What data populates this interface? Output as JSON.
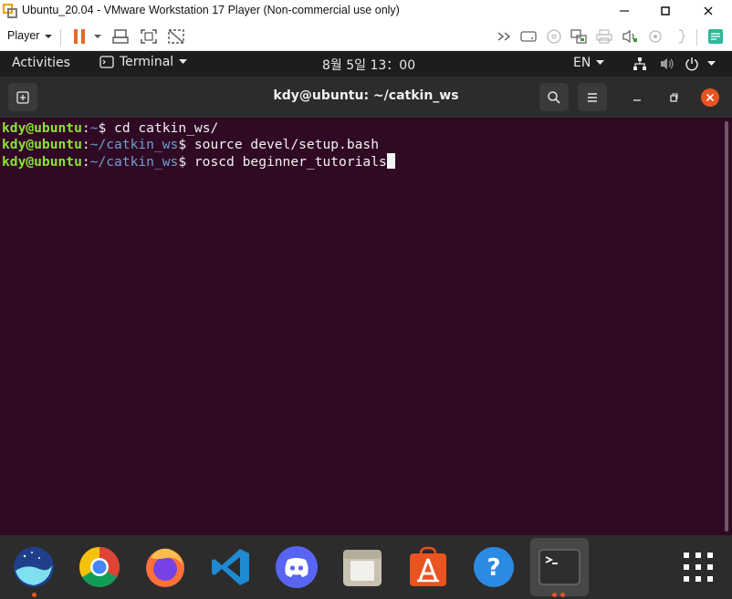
{
  "vm_window": {
    "title": "Ubuntu_20.04 - VMware Workstation 17 Player (Non-commercial use only)",
    "controls": [
      "minimize-icon",
      "maximize-icon",
      "close-icon"
    ]
  },
  "vm_toolbar": {
    "player_label": "Player",
    "icons": [
      "pause-icon",
      "dropdown-arrow-icon",
      "send-ctrl-alt-del-icon",
      "fit-guest-icon",
      "unity-icon",
      "fast-forward-icon",
      "hdd-icon",
      "cd-icon",
      "network-icon",
      "printer-icon",
      "sound-icon",
      "usb-icon",
      "more-icon",
      "notes-icon"
    ]
  },
  "gnome_panel": {
    "activities": "Activities",
    "app_menu": "Terminal",
    "clock": "8월 5일  13：00",
    "language": "EN"
  },
  "terminal": {
    "title": "kdy@ubuntu: ~/catkin_ws",
    "lines": [
      {
        "user": "kdy@ubuntu",
        "sep": ":",
        "path": "~",
        "cmd": "$ cd catkin_ws/"
      },
      {
        "user": "kdy@ubuntu",
        "sep": ":",
        "path": "~/catkin_ws",
        "cmd": "$ source devel/setup.bash"
      },
      {
        "user": "kdy@ubuntu",
        "sep": ":",
        "path": "~/catkin_ws",
        "cmd": "$ roscd beginner_tutorials"
      }
    ]
  },
  "colors": {
    "terminal_bg": "#300a24",
    "prompt_user": "#8ae234",
    "prompt_path": "#729fcf",
    "accent": "#e95420"
  },
  "dock": {
    "apps": [
      "whale-browser-icon",
      "chrome-icon",
      "firefox-icon",
      "vscode-icon",
      "discord-icon",
      "files-icon",
      "software-center-icon",
      "help-icon",
      "terminal-icon",
      "show-apps-icon"
    ]
  }
}
